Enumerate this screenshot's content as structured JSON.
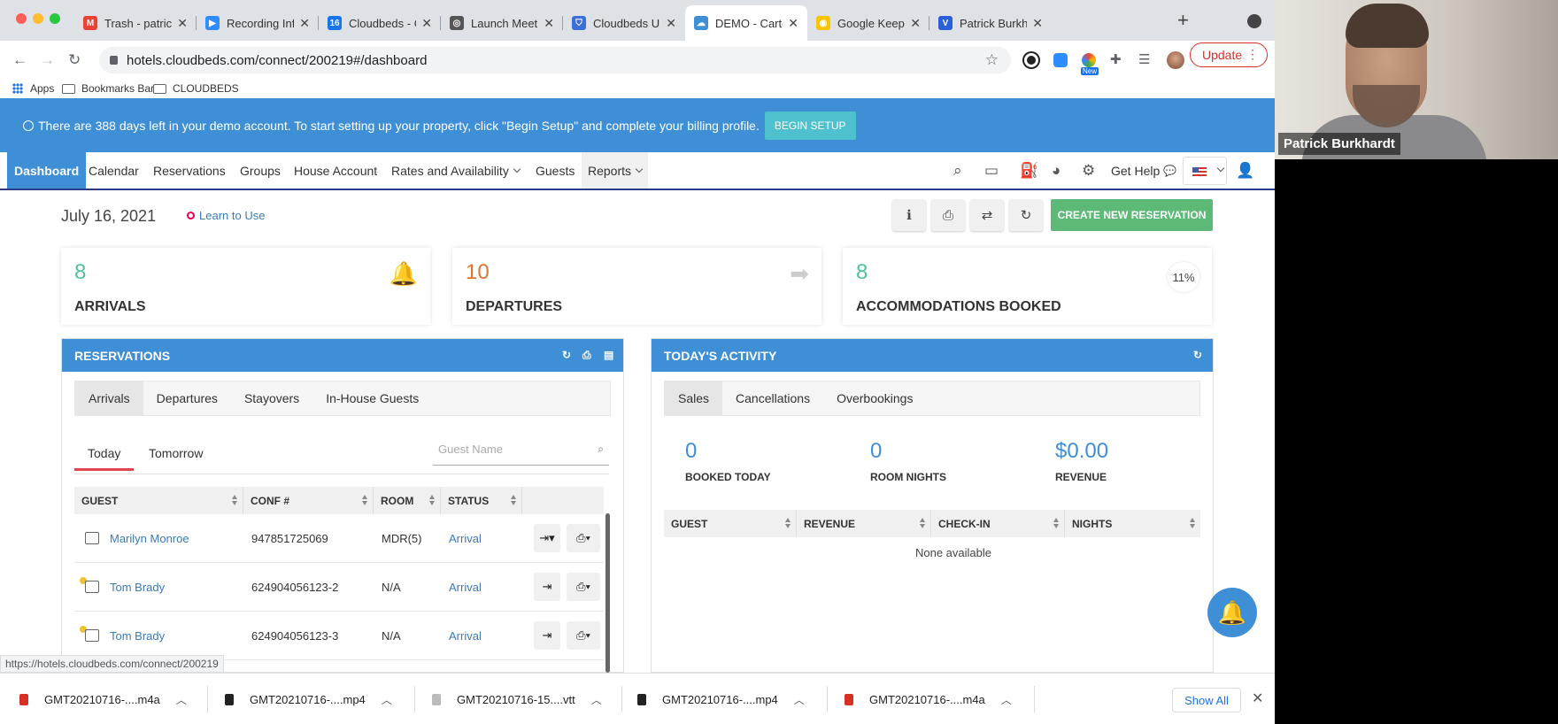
{
  "browser": {
    "tabs": [
      {
        "title": "Trash - patrick.b",
        "favicon_color": "#ea4335",
        "favicon_glyph": "M"
      },
      {
        "title": "Recording Inform",
        "favicon_color": "#2d8cff",
        "favicon_glyph": "▶"
      },
      {
        "title": "Cloudbeds - Cal",
        "favicon_color": "#1a73e8",
        "favicon_glyph": "16"
      },
      {
        "title": "Launch Meeting -",
        "favicon_color": "#555555",
        "favicon_glyph": "◎"
      },
      {
        "title": "Cloudbeds Unive",
        "favicon_color": "#3b6fd8",
        "favicon_glyph": "⛉"
      },
      {
        "title": "DEMO - Carte Bl",
        "favicon_color": "#3e8fd6",
        "favicon_glyph": "☁"
      },
      {
        "title": "Google Keep",
        "favicon_color": "#f9c500",
        "favicon_glyph": "◉"
      },
      {
        "title": "Patrick Burkhar",
        "favicon_color": "#2b5fd9",
        "favicon_glyph": "V"
      }
    ],
    "url": "hotels.cloudbeds.com/connect/200219#/dashboard",
    "update_label": "Update",
    "bookmarks": {
      "apps": "Apps",
      "bar": "Bookmarks Bar",
      "folder": "CLOUDBEDS"
    },
    "status_url": "https://hotels.cloudbeds.com/connect/200219",
    "new_badge": "New"
  },
  "banner": {
    "text": "There are 388 days left in your demo account. To start setting up your property, click \"Begin Setup\" and complete your billing profile.",
    "button": "BEGIN SETUP"
  },
  "nav": {
    "items": [
      "Dashboard",
      "Calendar",
      "Reservations",
      "Groups",
      "House Account",
      "Rates and Availability",
      "Guests",
      "Reports"
    ],
    "get_help": "Get Help"
  },
  "dashboard": {
    "date": "July 16, 2021",
    "learn": "Learn to Use",
    "create_button": "CREATE NEW RESERVATION",
    "stats": [
      {
        "value": "8",
        "label": "ARRIVALS",
        "color": "#4fc0a0"
      },
      {
        "value": "10",
        "label": "DEPARTURES",
        "color": "#e0742e"
      },
      {
        "value": "8",
        "label": "ACCOMMODATIONS BOOKED",
        "color": "#4fc0a0",
        "percent": "11%"
      }
    ]
  },
  "reservations": {
    "title": "RESERVATIONS",
    "tabs": [
      "Arrivals",
      "Departures",
      "Stayovers",
      "In-House Guests"
    ],
    "day_tabs": [
      "Today",
      "Tomorrow"
    ],
    "search_placeholder": "Guest Name",
    "columns": [
      "GUEST",
      "CONF #",
      "ROOM",
      "STATUS"
    ],
    "rows": [
      {
        "guest": "Marilyn Monroe",
        "conf": "947851725069",
        "room": "MDR(5)",
        "status": "Arrival"
      },
      {
        "guest": "Tom Brady",
        "conf": "624904056123-2",
        "room": "N/A",
        "status": "Arrival"
      },
      {
        "guest": "Tom Brady",
        "conf": "624904056123-3",
        "room": "N/A",
        "status": "Arrival"
      }
    ]
  },
  "activity": {
    "title": "TODAY'S ACTIVITY",
    "tabs": [
      "Sales",
      "Cancellations",
      "Overbookings"
    ],
    "metrics": [
      {
        "value": "0",
        "label": "BOOKED TODAY"
      },
      {
        "value": "0",
        "label": "ROOM NIGHTS"
      },
      {
        "value": "$0.00",
        "label": "REVENUE"
      }
    ],
    "columns": [
      "GUEST",
      "REVENUE",
      "CHECK-IN",
      "NIGHTS"
    ],
    "empty": "None available"
  },
  "downloads": {
    "items": [
      "GMT20210716-....m4a",
      "GMT20210716-....mp4",
      "GMT20210716-15....vtt",
      "GMT20210716-....mp4",
      "GMT20210716-....m4a"
    ],
    "show_all": "Show All"
  },
  "video": {
    "participant": "Patrick Burkhardt"
  }
}
